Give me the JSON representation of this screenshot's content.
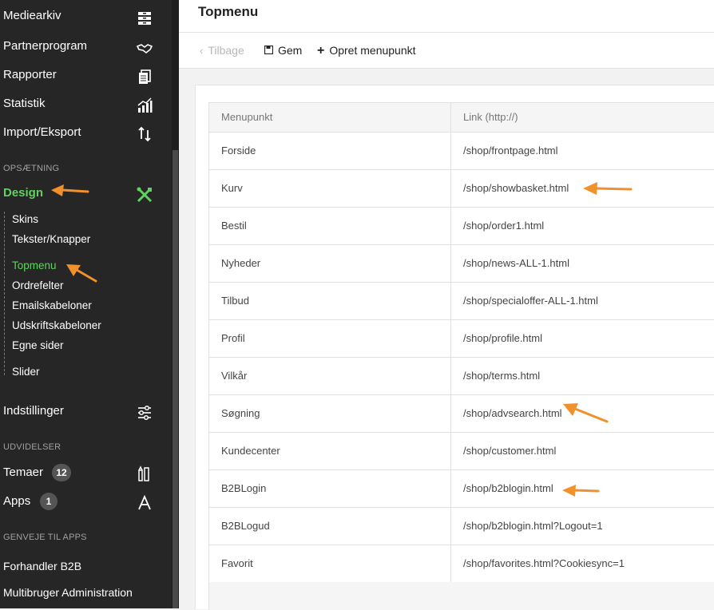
{
  "sidebar": {
    "nav_top": [
      {
        "label": "Mediearkiv",
        "icon": "archive-icon"
      },
      {
        "label": "Partnerprogram",
        "icon": "handshake-icon"
      },
      {
        "label": "Rapporter",
        "icon": "reports-icon"
      },
      {
        "label": "Statistik",
        "icon": "statistics-icon"
      },
      {
        "label": "Import/Eksport",
        "icon": "import-export-icon"
      }
    ],
    "section_setup": "OPSÆTNING",
    "design_label": "Design",
    "design_sub": [
      "Skins",
      "Tekster/Knapper",
      "Topmenu",
      "Ordrefelter",
      "Emailskabeloner",
      "Udskriftskabeloner",
      "Egne sider",
      "Slider"
    ],
    "active_sub": "Topmenu",
    "settings_label": "Indstillinger",
    "section_extensions": "UDVIDELSER",
    "themes_label": "Temaer",
    "themes_count": "12",
    "apps_label": "Apps",
    "apps_count": "1",
    "section_shortcuts": "GENVEJE TIL APPS",
    "shortcut_1": "Forhandler B2B",
    "shortcut_2": "Multibruger Administration",
    "active_color": "#5fd35f"
  },
  "header": {
    "title": "Topmenu"
  },
  "toolbar": {
    "back_label": "Tilbage",
    "save_label": "Gem",
    "create_label": "Opret menupunkt"
  },
  "table": {
    "columns": [
      "Menupunkt",
      "Link (http://)"
    ],
    "rows": [
      [
        "Forside",
        "/shop/frontpage.html"
      ],
      [
        "Kurv",
        "/shop/showbasket.html"
      ],
      [
        "Bestil",
        "/shop/order1.html"
      ],
      [
        "Nyheder",
        "/shop/news-ALL-1.html"
      ],
      [
        "Tilbud",
        "/shop/specialoffer-ALL-1.html"
      ],
      [
        "Profil",
        "/shop/profile.html"
      ],
      [
        "Vilkår",
        "/shop/terms.html"
      ],
      [
        "Søgning",
        "/shop/advsearch.html"
      ],
      [
        "Kundecenter",
        "/shop/customer.html"
      ],
      [
        "B2BLogin",
        "/shop/b2blogin.html"
      ],
      [
        "B2BLogud",
        "/shop/b2blogin.html?Logout=1"
      ],
      [
        "Favorit",
        "/shop/favorites.html?Cookiesync=1"
      ]
    ]
  },
  "annotation_color": "#f0912b"
}
